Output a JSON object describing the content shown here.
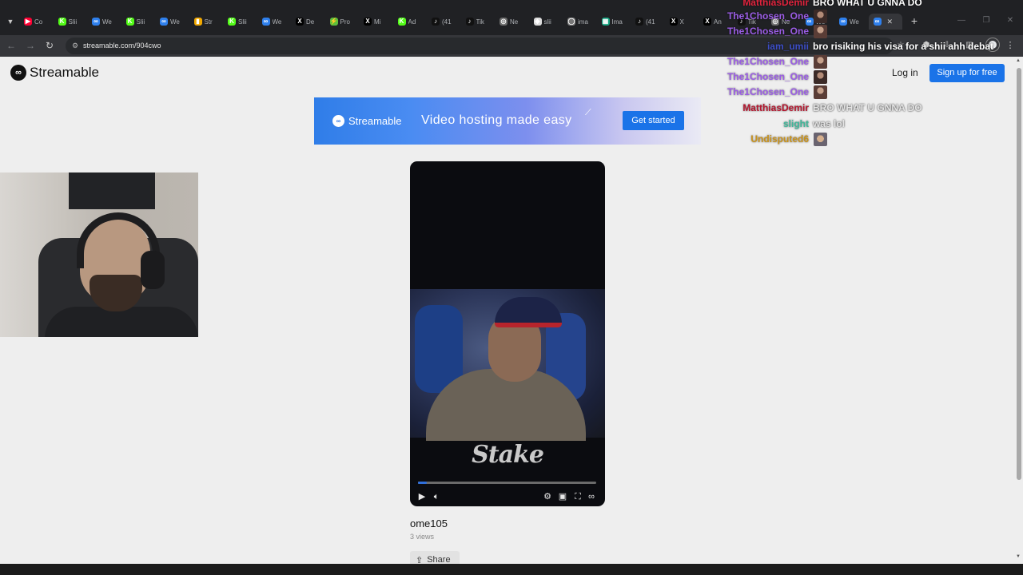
{
  "browser": {
    "tabs": [
      {
        "favicon": "youtube-favicon",
        "color": "#ff0033",
        "glyph": "▶",
        "label": "Co"
      },
      {
        "favicon": "kick-favicon",
        "color": "#53fc18",
        "glyph": "K",
        "label": "Slii"
      },
      {
        "favicon": "streamable-favicon",
        "color": "#2f80ed",
        "glyph": "∞",
        "label": "We"
      },
      {
        "favicon": "kick-favicon",
        "color": "#53fc18",
        "glyph": "K",
        "label": "Slii"
      },
      {
        "favicon": "streamable-favicon",
        "color": "#2f80ed",
        "glyph": "∞",
        "label": "We"
      },
      {
        "favicon": "chart-favicon",
        "color": "#f2a900",
        "glyph": "▮",
        "label": "Str"
      },
      {
        "favicon": "kick-favicon",
        "color": "#53fc18",
        "glyph": "K",
        "label": "Slii"
      },
      {
        "favicon": "streamable-favicon",
        "color": "#2f80ed",
        "glyph": "∞",
        "label": "We"
      },
      {
        "favicon": "x-favicon",
        "color": "#000000",
        "glyph": "X",
        "label": "De"
      },
      {
        "favicon": "prizepicks-favicon",
        "color": "#5fbf3a",
        "glyph": "⚡",
        "label": "Pro"
      },
      {
        "favicon": "x-favicon",
        "color": "#000000",
        "glyph": "X",
        "label": "Mi"
      },
      {
        "favicon": "kick-favicon",
        "color": "#53fc18",
        "glyph": "K",
        "label": "Ad"
      },
      {
        "favicon": "tiktok-favicon",
        "color": "#111111",
        "glyph": "♪",
        "label": "(41"
      },
      {
        "favicon": "tiktok-favicon",
        "color": "#111111",
        "glyph": "♪",
        "label": "Tik"
      },
      {
        "favicon": "chrome-favicon",
        "color": "#6d6d6d",
        "glyph": "◎",
        "label": "Ne"
      },
      {
        "favicon": "diamond-favicon",
        "color": "#dddddd",
        "glyph": "◆",
        "label": "slii"
      },
      {
        "favicon": "globe-favicon",
        "color": "#777777",
        "glyph": "◯",
        "label": "ima"
      },
      {
        "favicon": "image-favicon",
        "color": "#12a37f",
        "glyph": "▦",
        "label": "Ima"
      },
      {
        "favicon": "tiktok-favicon",
        "color": "#111111",
        "glyph": "♪",
        "label": "(41"
      },
      {
        "favicon": "x-favicon",
        "color": "#000000",
        "glyph": "X",
        "label": "X"
      },
      {
        "favicon": "x-favicon",
        "color": "#000000",
        "glyph": "X",
        "label": "An"
      },
      {
        "favicon": "tiktok-favicon",
        "color": "#111111",
        "glyph": "♪",
        "label": "Tik"
      },
      {
        "favicon": "chrome-favicon",
        "color": "#6d6d6d",
        "glyph": "◎",
        "label": "Ne"
      },
      {
        "favicon": "streamable-favicon",
        "color": "#2f80ed",
        "glyph": "∞",
        "label": "We"
      },
      {
        "favicon": "streamable-favicon",
        "color": "#2f80ed",
        "glyph": "∞",
        "label": "We"
      },
      {
        "favicon": "streamable-favicon",
        "color": "#2f80ed",
        "glyph": "∞",
        "label": "",
        "active": true
      }
    ],
    "url": "streamable.com/904cwo"
  },
  "site": {
    "logo_text": "Streamable",
    "login_label": "Log in",
    "signup_label": "Sign up for free",
    "accent_color": "#1a73e8"
  },
  "ad": {
    "logo_text": "Streamable",
    "headline": "Video hosting made easy",
    "cta_label": "Get started"
  },
  "video": {
    "watermark": "Stake",
    "title": "ome105",
    "views": "3 views",
    "share_label": "Share",
    "progress_fraction": 0.05,
    "buffered_fraction": 0.02
  },
  "chat": [
    {
      "user": "MatthiasDemir",
      "user_color": "#e0233d",
      "message": "BRO WHAT U GNNA DO",
      "message_color": "#ffffff"
    },
    {
      "user": "The1Chosen_One",
      "user_color": "#9b5de5",
      "emote": "person-emote"
    },
    {
      "user": "The1Chosen_One",
      "user_color": "#9b5de5",
      "emote": "person-emote"
    },
    {
      "user": "iam_umii",
      "user_color": "#3d4ec7",
      "message": "bro risiking his visa for a shii ahh debat",
      "message_color": "#ffffff"
    },
    {
      "user": "The1Chosen_One",
      "user_color": "#9b5de5",
      "emote": "person-emote"
    },
    {
      "user": "The1Chosen_One",
      "user_color": "#9b5de5",
      "emote": "person-emote"
    },
    {
      "user": "The1Chosen_One",
      "user_color": "#9b5de5",
      "emote": "person-emote"
    },
    {
      "user": "MatthiasDemir",
      "user_color": "#b5172f",
      "message": "BRO WHAT U GNNA DO",
      "message_color": "#e4e4e4"
    },
    {
      "user": "slight",
      "user_color": "#3fb89a",
      "message": "was lol",
      "message_color": "#e4e4e4"
    },
    {
      "user": "Undisputed6",
      "user_color": "#c8921c",
      "emote": "cap-emote"
    }
  ]
}
